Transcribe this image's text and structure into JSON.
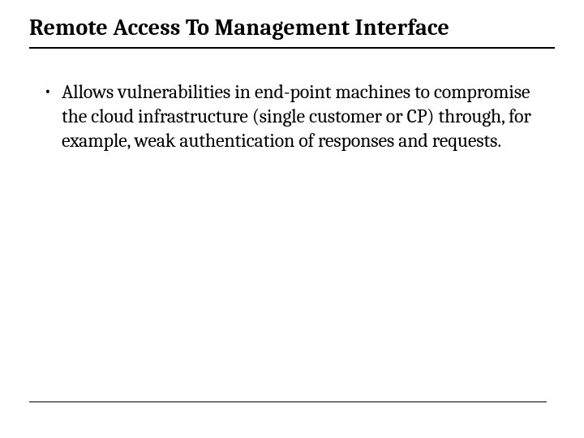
{
  "title": "Remote Access To Management Interface",
  "bullets": [
    {
      "text": "Allows vulnerabilities in end-point machines to compromise the cloud infrastructure (single customer or CP) through, for example, weak authentication of responses and requests."
    }
  ]
}
